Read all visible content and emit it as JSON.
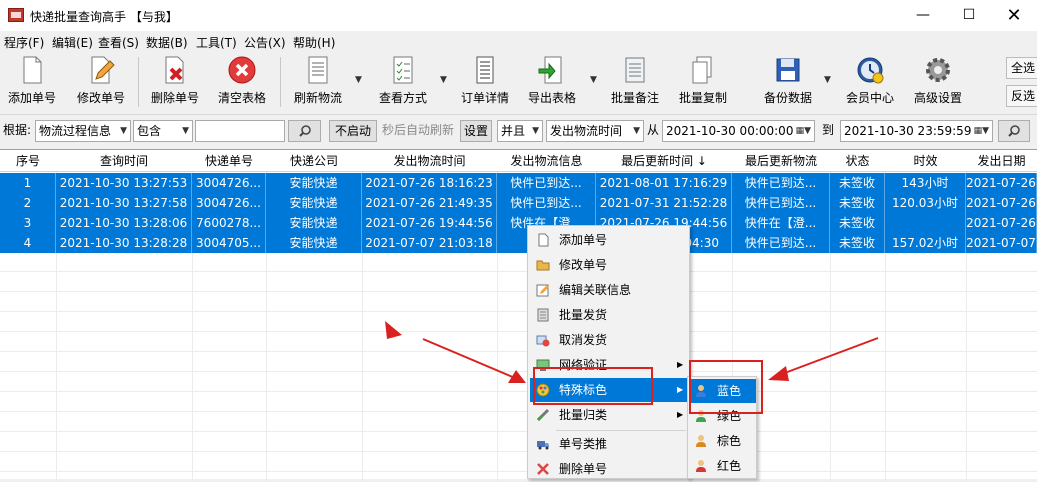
{
  "window": {
    "title": "快递批量查询高手 【与我】",
    "minimize": "—",
    "maximize": "☐",
    "close": "✕"
  },
  "menu": [
    "程序(F)",
    "编辑(E)",
    "查看(S)",
    "数据(B)",
    "工具(T)",
    "公告(X)",
    "帮助(H)"
  ],
  "toolbar": {
    "add": "添加单号",
    "edit": "修改单号",
    "delete": "删除单号",
    "clear": "清空表格",
    "refresh": "刷新物流",
    "view": "查看方式",
    "detail": "订单详情",
    "export": "导出表格",
    "note": "批量备注",
    "copy": "批量复制",
    "backup": "备份数据",
    "member": "会员中心",
    "settings": "高级设置",
    "select_all": "全选",
    "invert": "反选"
  },
  "filter": {
    "basis_label": "根据:",
    "field": "物流过程信息",
    "op": "包含",
    "query": "",
    "auto_state": "不启动",
    "auto_text": "秒后自动刷新",
    "set": "设置",
    "logic": "并且",
    "time_field": "发出物流时间",
    "from_label": "从",
    "from": "2021-10-30 00:00:00",
    "to_label": "到",
    "to": "2021-10-30 23:59:59"
  },
  "grid": {
    "columns": [
      "序号",
      "查询时间",
      "快递单号",
      "快递公司",
      "发出物流时间",
      "发出物流信息",
      "最后更新时间 ↓",
      "最后更新物流",
      "状态",
      "时效",
      "发出日期"
    ],
    "rows": [
      [
        "1",
        "2021-10-30 13:27:53",
        "3004726...",
        "安能快递",
        "2021-07-26 18:16:23",
        "快件已到达...",
        "2021-08-01 17:16:29",
        "快件已到达...",
        "未签收",
        "143小时",
        "2021-07-26"
      ],
      [
        "2",
        "2021-10-30 13:27:58",
        "3004726...",
        "安能快递",
        "2021-07-26 21:49:35",
        "快件已到达...",
        "2021-07-31 21:52:28",
        "快件已到达...",
        "未签收",
        "120.03小时",
        "2021-07-26"
      ],
      [
        "3",
        "2021-10-30 13:28:06",
        "7600278...",
        "安能快递",
        "2021-07-26 19:44:56",
        "快件在【澄...",
        "2021-07-26 19:44:56",
        "快件在【澄...",
        "未签收",
        "",
        "2021-07-26"
      ],
      [
        "4",
        "2021-10-30 13:28:28",
        "3004705...",
        "安能快递",
        "2021-07-07 21:03:18",
        "快件",
        "04:30",
        "快件已到达...",
        "未签收",
        "157.02小时",
        "2021-07-07"
      ]
    ]
  },
  "context_menu": [
    "添加单号",
    "修改单号",
    "编辑关联信息",
    "批量发货",
    "取消发货",
    "网络验证",
    "特殊标色",
    "批量归类",
    "单号类推",
    "删除单号"
  ],
  "submenu": [
    "蓝色",
    "绿色",
    "棕色",
    "红色"
  ],
  "colors": {
    "selection": "#0078d7",
    "annotation": "#d9211f",
    "blue": "#3b7dd8",
    "green": "#3fa34d",
    "brown": "#a0642a",
    "red": "#d33"
  }
}
